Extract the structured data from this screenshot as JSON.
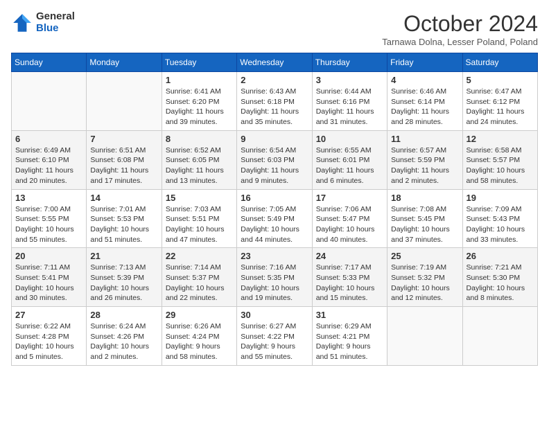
{
  "header": {
    "logo_general": "General",
    "logo_blue": "Blue",
    "month_title": "October 2024",
    "location": "Tarnawa Dolna, Lesser Poland, Poland"
  },
  "days_of_week": [
    "Sunday",
    "Monday",
    "Tuesday",
    "Wednesday",
    "Thursday",
    "Friday",
    "Saturday"
  ],
  "weeks": [
    [
      {
        "day": "",
        "empty": true
      },
      {
        "day": "",
        "empty": true
      },
      {
        "day": "1",
        "sunrise": "Sunrise: 6:41 AM",
        "sunset": "Sunset: 6:20 PM",
        "daylight": "Daylight: 11 hours and 39 minutes."
      },
      {
        "day": "2",
        "sunrise": "Sunrise: 6:43 AM",
        "sunset": "Sunset: 6:18 PM",
        "daylight": "Daylight: 11 hours and 35 minutes."
      },
      {
        "day": "3",
        "sunrise": "Sunrise: 6:44 AM",
        "sunset": "Sunset: 6:16 PM",
        "daylight": "Daylight: 11 hours and 31 minutes."
      },
      {
        "day": "4",
        "sunrise": "Sunrise: 6:46 AM",
        "sunset": "Sunset: 6:14 PM",
        "daylight": "Daylight: 11 hours and 28 minutes."
      },
      {
        "day": "5",
        "sunrise": "Sunrise: 6:47 AM",
        "sunset": "Sunset: 6:12 PM",
        "daylight": "Daylight: 11 hours and 24 minutes."
      }
    ],
    [
      {
        "day": "6",
        "sunrise": "Sunrise: 6:49 AM",
        "sunset": "Sunset: 6:10 PM",
        "daylight": "Daylight: 11 hours and 20 minutes."
      },
      {
        "day": "7",
        "sunrise": "Sunrise: 6:51 AM",
        "sunset": "Sunset: 6:08 PM",
        "daylight": "Daylight: 11 hours and 17 minutes."
      },
      {
        "day": "8",
        "sunrise": "Sunrise: 6:52 AM",
        "sunset": "Sunset: 6:05 PM",
        "daylight": "Daylight: 11 hours and 13 minutes."
      },
      {
        "day": "9",
        "sunrise": "Sunrise: 6:54 AM",
        "sunset": "Sunset: 6:03 PM",
        "daylight": "Daylight: 11 hours and 9 minutes."
      },
      {
        "day": "10",
        "sunrise": "Sunrise: 6:55 AM",
        "sunset": "Sunset: 6:01 PM",
        "daylight": "Daylight: 11 hours and 6 minutes."
      },
      {
        "day": "11",
        "sunrise": "Sunrise: 6:57 AM",
        "sunset": "Sunset: 5:59 PM",
        "daylight": "Daylight: 11 hours and 2 minutes."
      },
      {
        "day": "12",
        "sunrise": "Sunrise: 6:58 AM",
        "sunset": "Sunset: 5:57 PM",
        "daylight": "Daylight: 10 hours and 58 minutes."
      }
    ],
    [
      {
        "day": "13",
        "sunrise": "Sunrise: 7:00 AM",
        "sunset": "Sunset: 5:55 PM",
        "daylight": "Daylight: 10 hours and 55 minutes."
      },
      {
        "day": "14",
        "sunrise": "Sunrise: 7:01 AM",
        "sunset": "Sunset: 5:53 PM",
        "daylight": "Daylight: 10 hours and 51 minutes."
      },
      {
        "day": "15",
        "sunrise": "Sunrise: 7:03 AM",
        "sunset": "Sunset: 5:51 PM",
        "daylight": "Daylight: 10 hours and 47 minutes."
      },
      {
        "day": "16",
        "sunrise": "Sunrise: 7:05 AM",
        "sunset": "Sunset: 5:49 PM",
        "daylight": "Daylight: 10 hours and 44 minutes."
      },
      {
        "day": "17",
        "sunrise": "Sunrise: 7:06 AM",
        "sunset": "Sunset: 5:47 PM",
        "daylight": "Daylight: 10 hours and 40 minutes."
      },
      {
        "day": "18",
        "sunrise": "Sunrise: 7:08 AM",
        "sunset": "Sunset: 5:45 PM",
        "daylight": "Daylight: 10 hours and 37 minutes."
      },
      {
        "day": "19",
        "sunrise": "Sunrise: 7:09 AM",
        "sunset": "Sunset: 5:43 PM",
        "daylight": "Daylight: 10 hours and 33 minutes."
      }
    ],
    [
      {
        "day": "20",
        "sunrise": "Sunrise: 7:11 AM",
        "sunset": "Sunset: 5:41 PM",
        "daylight": "Daylight: 10 hours and 30 minutes."
      },
      {
        "day": "21",
        "sunrise": "Sunrise: 7:13 AM",
        "sunset": "Sunset: 5:39 PM",
        "daylight": "Daylight: 10 hours and 26 minutes."
      },
      {
        "day": "22",
        "sunrise": "Sunrise: 7:14 AM",
        "sunset": "Sunset: 5:37 PM",
        "daylight": "Daylight: 10 hours and 22 minutes."
      },
      {
        "day": "23",
        "sunrise": "Sunrise: 7:16 AM",
        "sunset": "Sunset: 5:35 PM",
        "daylight": "Daylight: 10 hours and 19 minutes."
      },
      {
        "day": "24",
        "sunrise": "Sunrise: 7:17 AM",
        "sunset": "Sunset: 5:33 PM",
        "daylight": "Daylight: 10 hours and 15 minutes."
      },
      {
        "day": "25",
        "sunrise": "Sunrise: 7:19 AM",
        "sunset": "Sunset: 5:32 PM",
        "daylight": "Daylight: 10 hours and 12 minutes."
      },
      {
        "day": "26",
        "sunrise": "Sunrise: 7:21 AM",
        "sunset": "Sunset: 5:30 PM",
        "daylight": "Daylight: 10 hours and 8 minutes."
      }
    ],
    [
      {
        "day": "27",
        "sunrise": "Sunrise: 6:22 AM",
        "sunset": "Sunset: 4:28 PM",
        "daylight": "Daylight: 10 hours and 5 minutes."
      },
      {
        "day": "28",
        "sunrise": "Sunrise: 6:24 AM",
        "sunset": "Sunset: 4:26 PM",
        "daylight": "Daylight: 10 hours and 2 minutes."
      },
      {
        "day": "29",
        "sunrise": "Sunrise: 6:26 AM",
        "sunset": "Sunset: 4:24 PM",
        "daylight": "Daylight: 9 hours and 58 minutes."
      },
      {
        "day": "30",
        "sunrise": "Sunrise: 6:27 AM",
        "sunset": "Sunset: 4:22 PM",
        "daylight": "Daylight: 9 hours and 55 minutes."
      },
      {
        "day": "31",
        "sunrise": "Sunrise: 6:29 AM",
        "sunset": "Sunset: 4:21 PM",
        "daylight": "Daylight: 9 hours and 51 minutes."
      },
      {
        "day": "",
        "empty": true
      },
      {
        "day": "",
        "empty": true
      }
    ]
  ]
}
